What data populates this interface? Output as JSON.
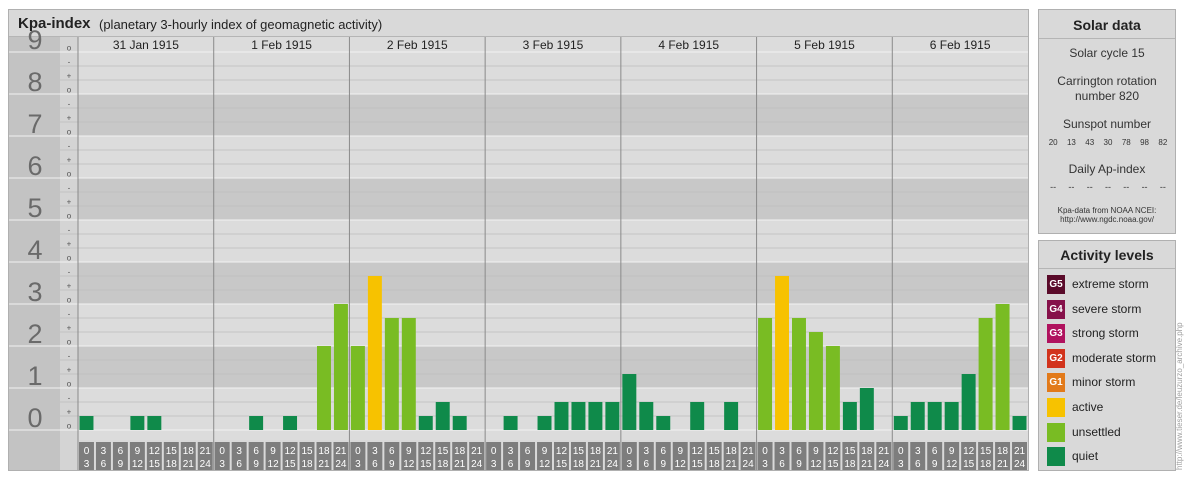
{
  "header": {
    "title": "Kpa-index",
    "subtitle": "(planetary 3-hourly index of geomagnetic activity)"
  },
  "chart_data": {
    "type": "bar",
    "y_axis_labels": [
      "0",
      "1",
      "2",
      "3",
      "4",
      "5",
      "6",
      "7",
      "8",
      "9"
    ],
    "y_sublabels": [
      "o",
      "+",
      "-",
      "o",
      "+",
      "-",
      "o",
      "+",
      "-",
      "o",
      "+",
      "-",
      "o",
      "+",
      "-",
      "o",
      "+",
      "-",
      "o",
      "+",
      "-",
      "o",
      "+",
      "-",
      "o",
      "+",
      "-",
      "o"
    ],
    "ylim": [
      0,
      9
    ],
    "days": [
      "31 Jan 1915",
      "1 Feb 1915",
      "2 Feb 1915",
      "3 Feb 1915",
      "4 Feb 1915",
      "5 Feb 1915",
      "6 Feb 1915"
    ],
    "interval_starts": [
      "0",
      "3",
      "6",
      "9",
      "12",
      "15",
      "18",
      "21"
    ],
    "interval_ends": [
      "3",
      "6",
      "9",
      "12",
      "15",
      "18",
      "21",
      "24"
    ],
    "values": [
      0.333,
      0,
      0,
      0.333,
      0.333,
      0,
      0,
      0,
      0,
      0,
      0.333,
      0,
      0.333,
      0,
      2,
      3,
      2,
      3.667,
      2.667,
      2.667,
      0.333,
      0.667,
      0.333,
      0,
      0,
      0.333,
      0,
      0.333,
      0.667,
      0.667,
      0.667,
      0.667,
      1.333,
      0.667,
      0.333,
      0,
      0.667,
      0,
      0.667,
      0,
      2.667,
      3.667,
      2.667,
      2.333,
      2,
      0.667,
      1,
      0,
      0.333,
      0.667,
      0.667,
      0.667,
      1.333,
      2.667,
      3,
      0.333
    ],
    "colors": {
      "quiet": "#0f8a4a",
      "unsettled": "#79bc23",
      "active": "#f7c200"
    },
    "grid": true
  },
  "solar": {
    "title": "Solar data",
    "cycle": "Solar cycle 15",
    "carrington_line1": "Carrington rotation",
    "carrington_line2": "number 820",
    "sunspot_title": "Sunspot number",
    "sunspot_values": [
      "20",
      "13",
      "43",
      "30",
      "78",
      "98",
      "82"
    ],
    "ap_title": "Daily Ap-index",
    "ap_values": [
      "--",
      "--",
      "--",
      "--",
      "--",
      "--",
      "--"
    ],
    "source_line1": "Kpa-data from NOAA NCEI:",
    "source_line2": "http://www.ngdc.noaa.gov/"
  },
  "levels": {
    "title": "Activity levels",
    "items": [
      {
        "badge": "G5",
        "label": "extreme storm",
        "color": "#5a0b2a"
      },
      {
        "badge": "G4",
        "label": "severe storm",
        "color": "#86114a"
      },
      {
        "badge": "G3",
        "label": "strong storm",
        "color": "#b0125e"
      },
      {
        "badge": "G2",
        "label": "moderate storm",
        "color": "#d2331c"
      },
      {
        "badge": "G1",
        "label": "minor storm",
        "color": "#e27a1a"
      },
      {
        "badge": "",
        "label": "active",
        "color": "#f7c200"
      },
      {
        "badge": "",
        "label": "unsettled",
        "color": "#79bc23"
      },
      {
        "badge": "",
        "label": "quiet",
        "color": "#0f8a4a"
      }
    ]
  },
  "credit": "http://www.tieser.de/leuzurzo_archive.php"
}
